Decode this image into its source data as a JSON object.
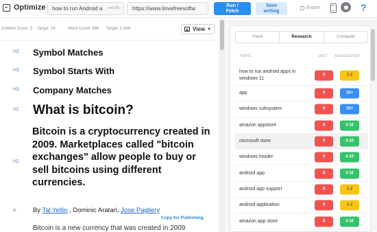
{
  "toolbar": {
    "brand": "Optimize",
    "keyword_value": "how to run Android a",
    "keyword_lang": "en-US",
    "url_value": "https://www.ilovefreesoftw",
    "run_label_1": "Run /",
    "run_label_2": "Fetch",
    "save_label_1": "Save",
    "save_label_2": "writing",
    "export_label": "Export",
    "icons": [
      "mobile-preview-icon",
      "gear-icon",
      "help-icon"
    ]
  },
  "stats": {
    "content_score": "Content Score: 3",
    "content_target": "Target: 28",
    "word_count": "Word Count: 888",
    "word_target": "Target: 1,049",
    "view_label": "View"
  },
  "editor": {
    "blocks": [
      {
        "tag": "H3",
        "text": "Symbol Matches"
      },
      {
        "tag": "H3",
        "text": "Symbol Starts With"
      },
      {
        "tag": "H3",
        "text": "Company Matches"
      },
      {
        "tag": "H1",
        "text": "What is bitcoin?"
      },
      {
        "tag": "H2",
        "text": "Bitcoin is a cryptocurrency created in 2009. Marketplaces called \"bitcoin exchanges\" allow people to buy or sell bitcoins using different currencies."
      },
      {
        "tag": "P",
        "text": ""
      }
    ],
    "byline_prefix": "By ",
    "author_1": "Tal Yellin",
    "byline_middle": " , Dominic Aratari, ",
    "author_3": "Jose Pagliery",
    "body_text": "Bitcoin is a new currency that was created in 2009",
    "copy_publishing": "Copy for Publishing"
  },
  "research": {
    "tabs": [
      "Feed",
      "Research",
      "Compete"
    ],
    "active_tab": "Research",
    "headers": {
      "topic": "TOPIC",
      "dist": "DIST",
      "suggested": "SUGGESTED"
    },
    "rows": [
      {
        "topic": "how to run android apps in windows 11",
        "dist": "0",
        "suggested": "1-2",
        "color": "yellow"
      },
      {
        "topic": "app",
        "dist": "0",
        "suggested": "10+",
        "color": "blue"
      },
      {
        "topic": "windows subsystem",
        "dist": "0",
        "suggested": "10+",
        "color": "blue"
      },
      {
        "topic": "amazon appstore",
        "dist": "0",
        "suggested": "3-10",
        "color": "green"
      },
      {
        "topic": "microsoft store",
        "dist": "0",
        "suggested": "3-10",
        "color": "green"
      },
      {
        "topic": "windows insider",
        "dist": "0",
        "suggested": "3-10",
        "color": "green"
      },
      {
        "topic": "android app",
        "dist": "0",
        "suggested": "3-10",
        "color": "green"
      },
      {
        "topic": "android app support",
        "dist": "0",
        "suggested": "1-2",
        "color": "yellow"
      },
      {
        "topic": "android application",
        "dist": "0",
        "suggested": "1-2",
        "color": "yellow"
      },
      {
        "topic": "amazon app store",
        "dist": "0",
        "suggested": "3-10",
        "color": "green"
      }
    ],
    "colors": {
      "dist": "#ef5350",
      "green": "#35c26a",
      "blue": "#3a8ef0",
      "yellow": "#f5c518"
    }
  }
}
